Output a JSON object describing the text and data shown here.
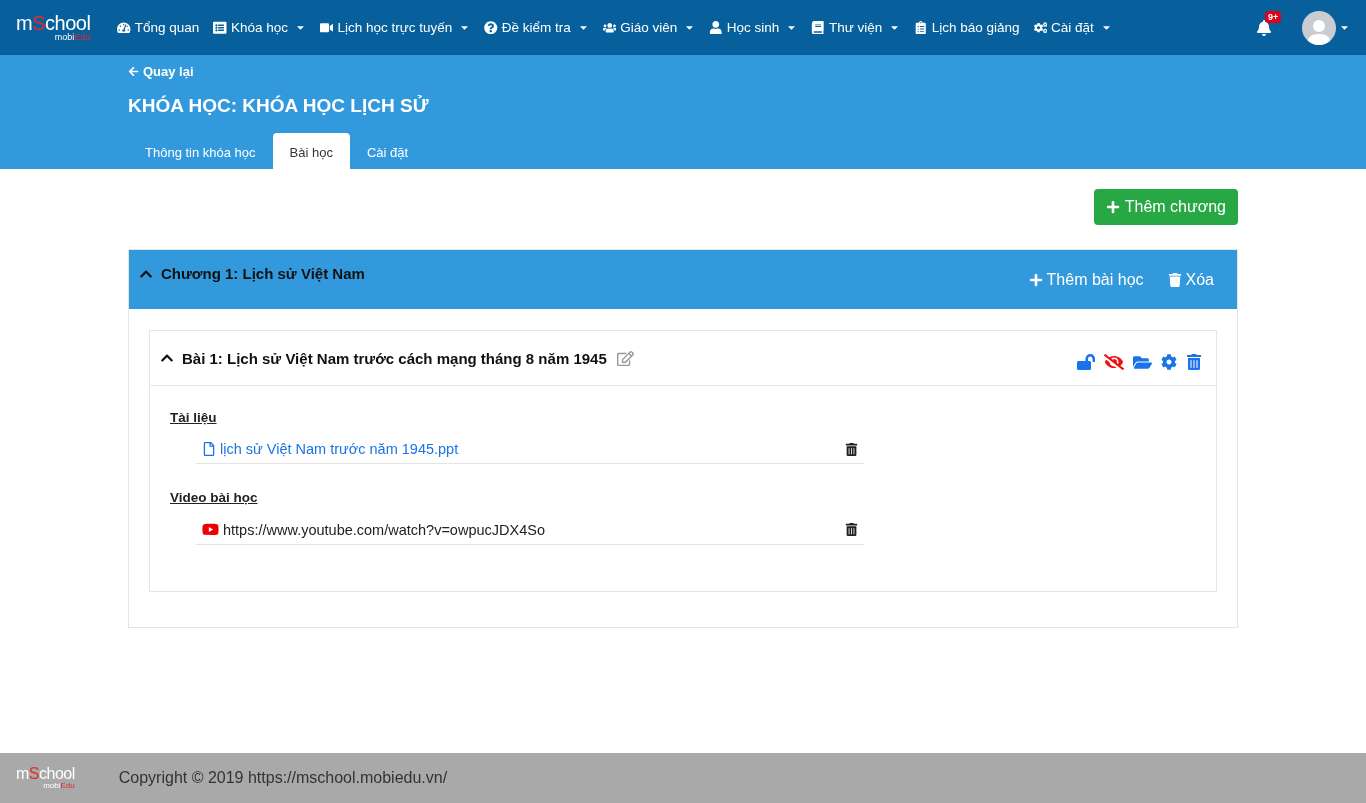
{
  "logo": {
    "lead": "m",
    "accent": "S",
    "rest": "chool",
    "sub_lead": "mobi",
    "sub_accent": "Edu"
  },
  "nav": [
    {
      "label": "Tổng quan",
      "dropdown": false
    },
    {
      "label": "Khóa học",
      "dropdown": true
    },
    {
      "label": "Lịch học trực tuyến",
      "dropdown": true
    },
    {
      "label": "Đề kiểm tra",
      "dropdown": true
    },
    {
      "label": "Giáo viên",
      "dropdown": true
    },
    {
      "label": "Học sinh",
      "dropdown": true
    },
    {
      "label": "Thư viện",
      "dropdown": true
    },
    {
      "label": "Lịch báo giảng",
      "dropdown": false
    },
    {
      "label": "Cài đặt",
      "dropdown": true
    }
  ],
  "notifications": {
    "badge": "9+"
  },
  "back_link": "Quay lại",
  "page_title": "KHÓA HỌC: KHÓA HỌC LỊCH SỬ",
  "tabs": [
    {
      "label": "Thông tin khóa học",
      "selected": false
    },
    {
      "label": "Bài học",
      "selected": true
    },
    {
      "label": "Cài đặt",
      "selected": false
    }
  ],
  "add_chapter_button": "Thêm chương",
  "chapters": [
    {
      "title": "Chương 1: Lịch sử Việt Nam",
      "expanded": true,
      "add_lesson_button": "Thêm bài học",
      "delete_button": "Xóa",
      "lessons": [
        {
          "title": "Bài 1: Lịch sử Việt Nam trước cách mạng tháng 8 năm 1945",
          "expanded": true,
          "locked": false,
          "hidden": true,
          "sections": [
            {
              "heading": "Tài liệu",
              "items": [
                {
                  "kind": "file",
                  "text": "lịch sử Việt Nam trước năm 1945.ppt"
                }
              ]
            },
            {
              "heading": "Video bài học",
              "items": [
                {
                  "kind": "youtube",
                  "text": "https://www.youtube.com/watch?v=owpucJDX4So"
                }
              ]
            }
          ]
        }
      ]
    }
  ],
  "footer": {
    "logo": {
      "lead": "m",
      "accent": "S",
      "rest": "chool",
      "sub_lead": "mobi",
      "sub_accent": "Edu"
    },
    "copyright": "Copyright © 2019 https://mschool.mobiedu.vn/"
  }
}
